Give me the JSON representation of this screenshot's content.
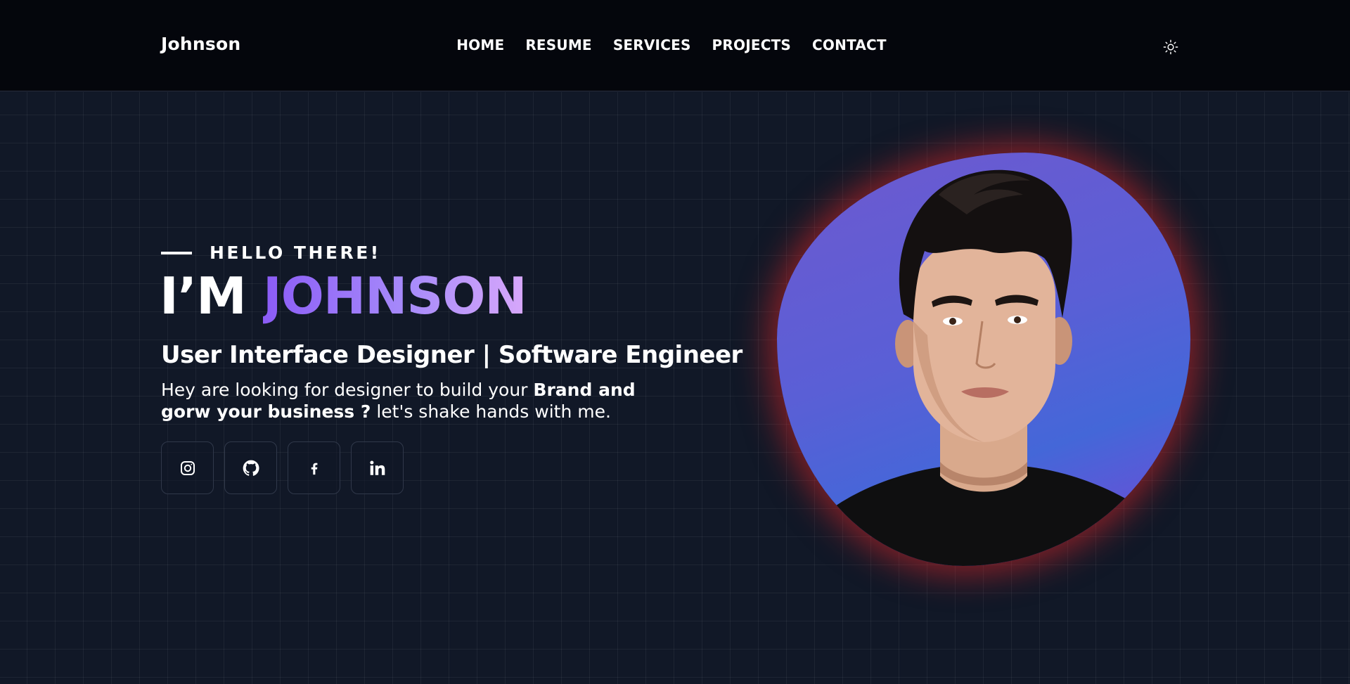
{
  "header": {
    "logo": "Johnson",
    "nav": [
      "HOME",
      "RESUME",
      "SERVICES",
      "PROJECTS",
      "CONTACT"
    ],
    "theme_toggle_icon": "sun-icon"
  },
  "hero": {
    "greeting": "HELLO THERE!",
    "headline_prefix": "I’M ",
    "headline_name": "JOHNSON",
    "subtitle": "User Interface Designer | Software Engineer",
    "desc_part1": "Hey are looking for designer to build your ",
    "desc_bold1": "Brand and",
    "desc_bold2": "gorw your business ?",
    "desc_part2": " let's shake hands with me.",
    "socials": [
      {
        "icon": "instagram-icon"
      },
      {
        "icon": "github-icon"
      },
      {
        "icon": "facebook-icon"
      },
      {
        "icon": "linkedin-icon"
      }
    ],
    "portrait_icon": "profile-photo"
  },
  "colors": {
    "header_bg": "#04060c",
    "page_bg": "#111827",
    "accent_start": "#8b5cf6",
    "accent_end": "#d8a8fb",
    "glow": "#dc2626"
  }
}
